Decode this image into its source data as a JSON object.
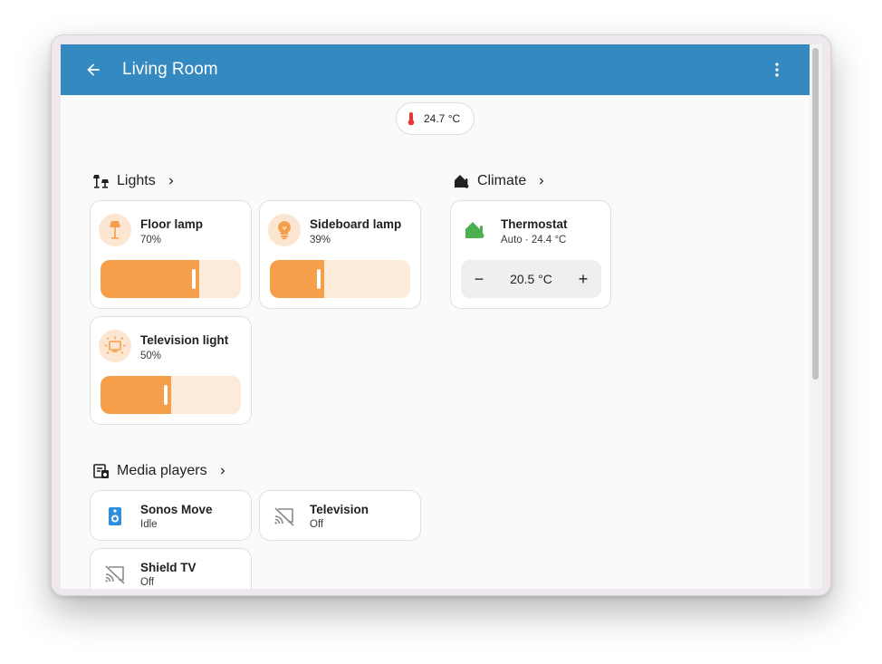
{
  "header": {
    "title": "Living Room"
  },
  "badge": {
    "temperature": "24.7 °C"
  },
  "sections": {
    "lights": {
      "title": "Lights"
    },
    "climate": {
      "title": "Climate"
    },
    "media": {
      "title": "Media players"
    }
  },
  "lights": [
    {
      "name": "Floor lamp",
      "state": "70%",
      "brightness": 0.7,
      "icon": "floor-lamp-icon"
    },
    {
      "name": "Sideboard lamp",
      "state": "39%",
      "brightness": 0.39,
      "icon": "lightbulb-icon"
    },
    {
      "name": "Television light",
      "state": "50%",
      "brightness": 0.5,
      "icon": "television-ambient-light-icon"
    }
  ],
  "climate": {
    "name": "Thermostat",
    "state": "Auto · 24.4 °C",
    "target": "20.5 °C",
    "decrease": "−",
    "increase": "+"
  },
  "media": [
    {
      "name": "Sonos Move",
      "state": "Idle",
      "icon": "speaker-icon"
    },
    {
      "name": "Television",
      "state": "Off",
      "icon": "cast-off-icon"
    },
    {
      "name": "Shield TV",
      "state": "Off",
      "icon": "cast-off-icon"
    }
  ],
  "colors": {
    "header": "#3389c0",
    "light_accent": "#f59f4a",
    "light_track": "#fdebd9",
    "climate_accent": "#4caf50",
    "speaker_accent": "#2f8fde",
    "thermometer": "#e53935"
  }
}
